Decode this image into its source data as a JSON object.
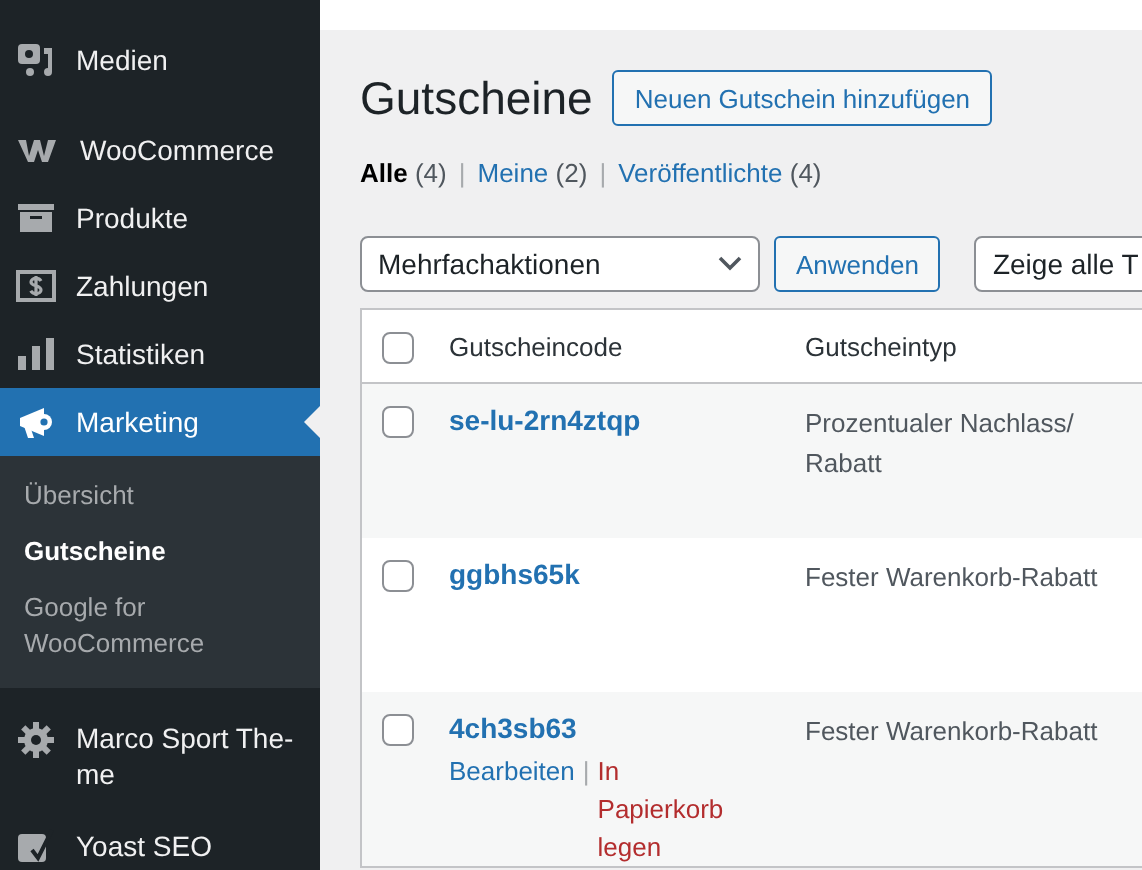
{
  "sidebar": {
    "items": [
      {
        "label": "Medien",
        "selected": false
      },
      {
        "label": "WooCommerce",
        "selected": false
      },
      {
        "label": "Produkte",
        "selected": false
      },
      {
        "label": "Zahlungen",
        "selected": false
      },
      {
        "label": "Statistiken",
        "selected": false
      },
      {
        "label": "Marketing",
        "selected": true,
        "submenu": [
          {
            "label": "Übersicht",
            "selected": false
          },
          {
            "label": "Gutscheine",
            "selected": true
          },
          {
            "label": "Google for WooCommerce",
            "selected": false
          }
        ]
      },
      {
        "label": "Marco Sport The-me",
        "selected": false
      },
      {
        "label": "Yoast SEO",
        "selected": false
      }
    ]
  },
  "page": {
    "title": "Gutscheine",
    "add_button": "Neuen Gutschein hinzufügen",
    "views": [
      {
        "label": "Alle",
        "count": "(4)",
        "selected": true
      },
      {
        "separator": "|",
        "label": "Meine",
        "count": "(2)",
        "selected": false
      },
      {
        "separator": "|",
        "label": "Veröffentlichte",
        "count": "(4)",
        "selected": false
      }
    ],
    "bulk_actions": {
      "value": "Mehrfachaktionen"
    },
    "apply_button": "Anwenden",
    "filter": {
      "value": "Zeige alle T"
    }
  },
  "table": {
    "header_checked": false,
    "columns": [
      "Gutscheincode",
      "Gutscheintyp"
    ],
    "rows": [
      {
        "code": "se-lu-2rn4ztqp",
        "type": "Prozentualer Nachlass/ Rabatt",
        "checked": false
      },
      {
        "code": "ggbhs65k",
        "type": "Fester Warenkorb-Rabatt",
        "checked": false
      },
      {
        "code": "4ch3sb63",
        "type": "Fester Warenkorb-Rabatt",
        "checked": false,
        "actions": [
          {
            "label": "Bearbeiten",
            "kind": "edit"
          },
          {
            "separator": "|",
            "label": "In Papierkorb legen",
            "kind": "trash"
          }
        ]
      }
    ]
  }
}
